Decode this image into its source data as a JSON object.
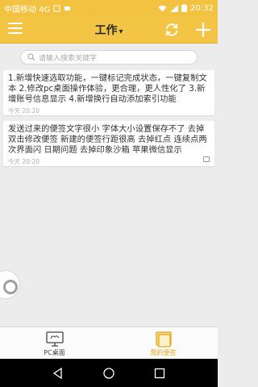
{
  "status": {
    "carrier": "中国移动 4G",
    "time": "20:32"
  },
  "toolbar": {
    "title": "工作",
    "chevron": "▾"
  },
  "search": {
    "placeholder": "请输入搜索关键字"
  },
  "notes": [
    {
      "text": "1.新增快速选取功能，一键标记完成状态，一键复制文本 2.修改pc桌面操作体验，更合理，更人性化了 3.新增账号信息显示 4.新增换行自动添加索引功能",
      "time": "今天 20:20"
    },
    {
      "text": "发送过来的便签文字很小 字体大小设置保存不了 去掉双击修改便签 新建的便签行距很高 去掉红点 连续点两次界面闪 日期问题 去掉印象沙箱 苹果微信显示",
      "time": "今天 20:20"
    }
  ],
  "bottom_nav": [
    {
      "label": "PC桌面",
      "icon": "monitor-icon",
      "active": false
    },
    {
      "label": "我的便签",
      "icon": "note-icon",
      "active": true
    }
  ],
  "colors": {
    "accent": "#f4c445",
    "active_tab": "#e9a51b"
  }
}
